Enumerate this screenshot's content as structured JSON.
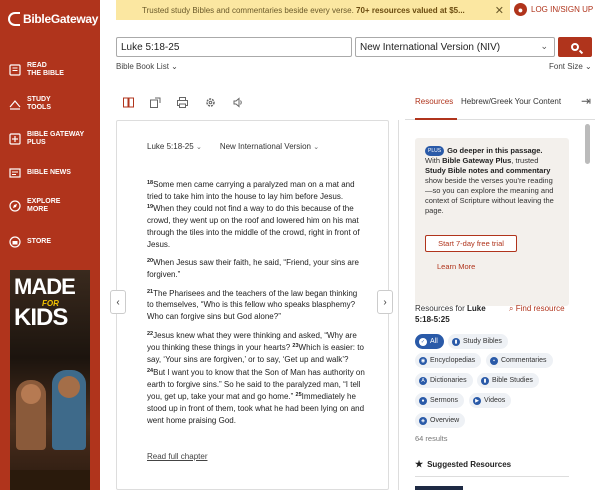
{
  "brand": {
    "name": "BibleGateway"
  },
  "sidebar": {
    "items": [
      {
        "label": "READ\nTHE BIBLE",
        "icon": "book-icon"
      },
      {
        "label": "STUDY\nTOOLS",
        "icon": "study-icon"
      },
      {
        "label": "BIBLE GATEWAY\nPLUS",
        "icon": "plus-icon"
      },
      {
        "label": "BIBLE NEWS",
        "icon": "news-icon"
      },
      {
        "label": "EXPLORE\nMORE",
        "icon": "compass-icon"
      },
      {
        "label": "STORE",
        "icon": "store-icon"
      }
    ],
    "ad": {
      "line1": "MADE",
      "line2": "FOR",
      "line3": "KIDS"
    }
  },
  "banner": {
    "text": "Trusted study Bibles and commentaries beside every verse. ",
    "bold": "70+ resources valued at $5..."
  },
  "login": {
    "label": "LOG IN/SIGN UP"
  },
  "search": {
    "passage": "Luke 5:18-25",
    "version": "New International Version (NIV)",
    "book_list": "Bible Book List",
    "font_size": "Font Size"
  },
  "tabs": {
    "resources": "Resources",
    "hebrew_greek": "Hebrew/Greek Your Content"
  },
  "reading": {
    "passage": "Luke 5:18-25",
    "version": "New International Version",
    "paragraphs": [
      [
        {
          "v": "18",
          "t": "Some men came carrying a paralyzed man on a mat and tried to take him into the house to lay him before Jesus. "
        },
        {
          "v": "19",
          "t": "When they could not find a way to do this because of the crowd, they went up on the roof and lowered him on his mat through the tiles into the middle of the crowd, right in front of Jesus."
        }
      ],
      [
        {
          "v": "20",
          "t": "When Jesus saw their faith, he said, “Friend, your sins are forgiven.”"
        }
      ],
      [
        {
          "v": "21",
          "t": "The Pharisees and the teachers of the law began thinking to themselves, “Who is this fellow who speaks blasphemy? Who can forgive sins but God alone?”"
        }
      ],
      [
        {
          "v": "22",
          "t": "Jesus knew what they were thinking and asked, “Why are you thinking these things in your hearts? "
        },
        {
          "v": "23",
          "t": "Which is easier: to say, ‘Your sins are forgiven,’ or to say, ‘Get up and walk’? "
        },
        {
          "v": "24",
          "t": "But I want you to know that the Son of Man has authority on earth to forgive sins.” So he said to the paralyzed man, “I tell you, get up, take your mat and go home.” "
        },
        {
          "v": "25",
          "t": "Immediately he stood up in front of them, took what he had been lying on and went home praising God."
        }
      ]
    ],
    "read_full": "Read full chapter"
  },
  "plus_card": {
    "badge": "PLUS",
    "heading": "Go deeper in this passage.",
    "t1": " With ",
    "b1": "Bible Gateway Plus",
    "t2": ", trusted ",
    "b2": "Study Bible notes and commentary",
    "t3": " show beside the verses you're reading—so you can explore the meaning and context of Scripture without leaving the page.",
    "trial": "Start 7-day free trial",
    "learn_more": "Learn More"
  },
  "resources": {
    "for_label": "Resources for ",
    "for_ref": "Luke 5:18-5:25",
    "find": "Find resource",
    "chips": [
      "All",
      "Study Bibles",
      "Encyclopedias",
      "Commentaries",
      "Dictionaries",
      "Bible Studies",
      "Sermons",
      "Videos",
      "Overview"
    ],
    "count": "64 results",
    "suggested": "Suggested Resources"
  }
}
